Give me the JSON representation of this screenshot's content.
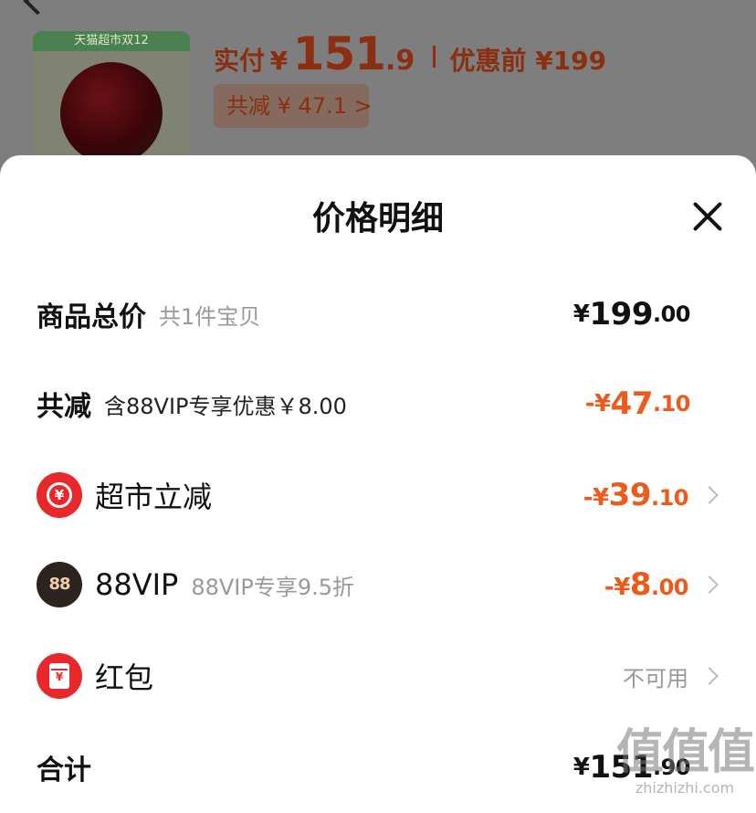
{
  "background": {
    "thumb_banner": "天猫超市双12",
    "paid_label": "实付",
    "paid_currency": "¥",
    "paid_int": "151",
    "paid_dec": ".9",
    "original_label": "优惠前 ¥199",
    "saved_label": "共减 ¥ 47.1 >"
  },
  "sheet": {
    "title": "价格明细",
    "rows": {
      "subtotal": {
        "label": "商品总价",
        "sub": "共1件宝贝",
        "cur": "¥",
        "int": "199",
        "dec": ".00"
      },
      "discount": {
        "label": "共减",
        "note": "含88VIP专享优惠￥8.00",
        "cur": "-¥",
        "int": "47",
        "dec": ".10"
      },
      "market": {
        "label": "超市立减",
        "icon_text": "¥",
        "cur": "-¥",
        "int": "39",
        "dec": ".10"
      },
      "vip": {
        "label": "88VIP",
        "sub": "88VIP专享9.5折",
        "icon_text": "88",
        "cur": "-¥",
        "int": "8",
        "dec": ".00"
      },
      "redpacket": {
        "label": "红包",
        "icon_text": "¥",
        "status": "不可用"
      },
      "total": {
        "label": "合计",
        "cur": "¥",
        "int": "151",
        "dec": ".90"
      }
    }
  },
  "watermark": {
    "main": "值值值",
    "site": "zhizhizhi.com"
  },
  "colors": {
    "accent": "#ec5b1c",
    "icon_red": "#e8282a",
    "vip_dark": "#2c2420",
    "overlay": "#7e7e7e"
  },
  "icons": [
    "back-icon",
    "close-icon",
    "market-discount-icon",
    "vip-88-icon",
    "red-packet-icon",
    "chevron-right-icon"
  ]
}
